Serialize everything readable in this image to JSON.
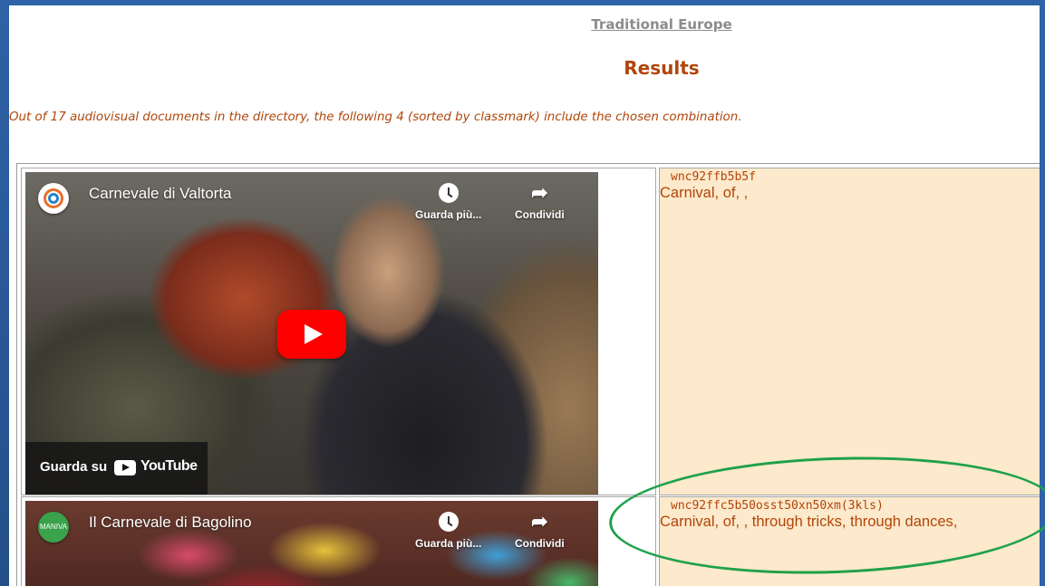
{
  "nav": {
    "link_label": "Traditional Europe"
  },
  "results": {
    "title": "Results",
    "summary": "Out of 17 audiovisual documents in the directory, the following 4 (sorted by classmark) include the chosen combination."
  },
  "rows": [
    {
      "video": {
        "title": "Carnevale di Valtorta",
        "watch_later": "Guarda più...",
        "share": "Condividi",
        "watch_on_label": "Guarda su",
        "youtube_word": "YouTube"
      },
      "classmark": "wnc92ffb5b5f",
      "keywords": "Carnival, of, ,"
    },
    {
      "video": {
        "title": "Il Carnevale di Bagolino",
        "channel_logo_text": "MANIVA",
        "watch_later": "Guarda più...",
        "share": "Condividi"
      },
      "classmark": "wnc92ffc5b50osst50xn50xm(3kls)",
      "keywords": "Carnival, of, , through tricks, through dances,"
    }
  ],
  "annotation": {
    "color": "#1fa14a"
  }
}
